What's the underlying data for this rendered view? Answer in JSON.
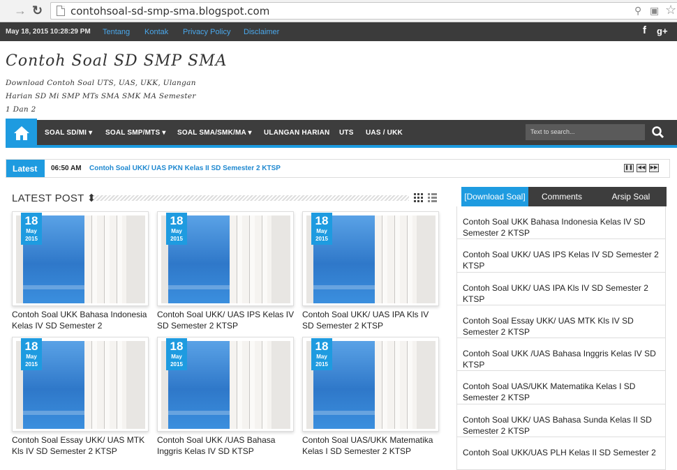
{
  "browser": {
    "url": "contohsoal-sd-smp-sma.blogspot.com"
  },
  "topbar": {
    "date": "May 18, 2015 10:28:29 PM",
    "links": [
      "Tentang",
      "Kontak",
      "Privacy Policy",
      "Disclaimer"
    ],
    "social": [
      "f",
      "g+"
    ]
  },
  "header": {
    "title": "Contoh Soal SD SMP SMA",
    "description": "Download Contoh Soal UTS, UAS, UKK, Ulangan Harian SD Mi SMP MTs SMA SMK MA Semester 1 Dan 2"
  },
  "nav": {
    "items": [
      "SOAL SD/MI",
      "SOAL SMP/MTS",
      "SOAL SMA/SMK/MA",
      "ULANGAN HARIAN",
      "UTS",
      "UAS / UKK"
    ],
    "search_placeholder": "Text to search..."
  },
  "ticker": {
    "label": "Latest",
    "time": "06:50 AM",
    "text": "Contoh Soal UKK/ UAS PKN Kelas II SD Semester 2 KTSP"
  },
  "latest": {
    "heading": "LATEST POST",
    "posts": [
      {
        "day": "18",
        "month": "May",
        "year": "2015",
        "title": "Contoh Soal UKK Bahasa Indonesia Kelas IV SD Semester 2"
      },
      {
        "day": "18",
        "month": "May",
        "year": "2015",
        "title": "Contoh Soal UKK/ UAS IPS Kelas IV SD Semester 2 KTSP"
      },
      {
        "day": "18",
        "month": "May",
        "year": "2015",
        "title": "Contoh Soal UKK/ UAS IPA Kls IV SD Semester 2 KTSP"
      },
      {
        "day": "18",
        "month": "May",
        "year": "2015",
        "title": "Contoh Soal Essay UKK/ UAS MTK Kls IV SD Semester 2 KTSP"
      },
      {
        "day": "18",
        "month": "May",
        "year": "2015",
        "title": "Contoh Soal UKK /UAS Bahasa Inggris Kelas IV SD KTSP"
      },
      {
        "day": "18",
        "month": "May",
        "year": "2015",
        "title": "Contoh Soal UAS/UKK Matematika Kelas I SD Semester 2 KTSP"
      }
    ]
  },
  "sidebar": {
    "tabs": [
      "[Download Soal]",
      "Comments",
      "Arsip Soal"
    ],
    "items": [
      "Contoh Soal UKK Bahasa Indonesia Kelas IV SD Semester 2 KTSP",
      "Contoh Soal UKK/ UAS IPS Kelas IV SD Semester 2 KTSP",
      "Contoh Soal UKK/ UAS IPA Kls IV SD Semester 2 KTSP",
      "Contoh Soal Essay UKK/ UAS MTK Kls IV SD Semester 2 KTSP",
      "Contoh Soal UKK /UAS Bahasa Inggris Kelas IV SD KTSP",
      "Contoh Soal UAS/UKK Matematika Kelas I SD Semester 2 KTSP",
      "Contoh Soal UKK/ UAS Bahasa Sunda Kelas II SD Semester 2 KTSP",
      "Contoh Soal UKK/UAS PLH Kelas II SD Semester 2"
    ]
  }
}
